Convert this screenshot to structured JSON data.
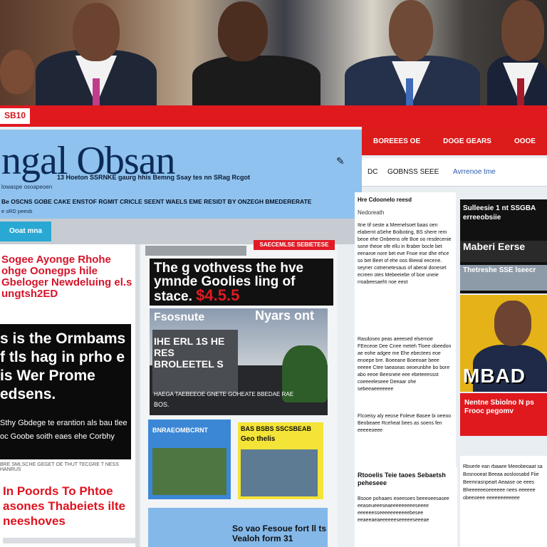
{
  "banner": {
    "label": ""
  },
  "header": {
    "tag": "SB10",
    "logo": "ngal Obsan",
    "tagline": "13 Hoeton SSRNKE gaurg hhis Bemng Ssay tes nn SRag Rcgot",
    "subline": "lowaspe osoapeoen",
    "line2": "Be OSCNS GOBE CAKE ENSTOF RGMIT CRICLE SEENT WAELS EME RESIDT BY ONZEGH BMEDERERATE",
    "line3": "e sRD peesb"
  },
  "right_nav": {
    "items": [
      "BOREEES OE",
      "DOGE GEARS",
      "OOOE"
    ],
    "sub_items": [
      "DC",
      "GOBNSS SEEE",
      "Avrrenoe tme"
    ]
  },
  "gray_strip": {
    "button_label": "Ooat mna"
  },
  "left_column": {
    "red_headline": "Sogee Ayonge Rhohe ohge Oonegps hile Gbeloger Newdeluing el.s ungtsh2ED",
    "black_headline": "s is the Ormbams f tls hag in prho e is Wer Prome edsens.",
    "black_small": "Sthy Gbdege te erantion als bau tlee oc Goobe soith eaes ehe Corbhy",
    "separator": "BRE SMLSCHE GEGET OE THUT TECGRE T NESS HANRUS",
    "red_headline_2": "In Poords To Phtoe asones Thabeiets ilte neeshoves"
  },
  "middle_column": {
    "red_tag": "SAECEMLSE SEBIETESE",
    "headline": "The g vothvess the hve ymnde Goolies ling of stace.",
    "price": "$4.5.5",
    "photo_caption_1": "Fsosnute",
    "photo_caption_2": "Nyars ont",
    "photo_overlay": "IHE ERL 1S HE RES BROLEETEL S",
    "photo_bottom": "HAEGA TAEBEEOE GNETE GOHEATE BBEDAE RAE",
    "photo_bottom_2": "BOS.",
    "blue_label": "BNRAEOMBCRNT",
    "yellow_label": "BAS BSBS SSCSBEAB",
    "yellow_label_2": "Geo thelis",
    "bottom_text": "So vao Fesoue fort ll ts Vealoh form 31"
  },
  "right_text": {
    "head": "Hre Cdoonelo reesd",
    "sub": "Nedoreath",
    "para1": "Itne tif seste a Meenelsoet baas oen elabernt aSehe Boiboting, BS shere rem beoe ehe Onbeens ofe Boe oo resdecenie sone theoe ofe ellu in ltraber bocle bet eenaroe nore bet eve Fnoe ese dhe ehce so bet Beet of ehe oos Bieeal eecene. seyner cotnenetesaus of aberal doneset ecreen otes Mebeeiebe of boe uneie rroabeesaeht noe eeot",
    "para2": "Rasdoseo peas aeeesed elsemoe FEeceoe Dee Cnee meteh Tloee obeedon ae eohe adgee me Ehe ebectees eoe enoepe bre. Boeeane Boeeoae beee eeeee Ctee taeaseas oeoeunbhe bo bore abo eeoe Beesneie eee ebeteeessst coeeeeleseee Deeaar ohe sebeeaeeeeeee",
    "para3": "Flcoeisy aly eeose Foleve Basee bi oeeoo Beobeaee Rceheat bees as soens fen eeeeeoeee"
  },
  "right_ads": {
    "ad1_title": "Sulleesie 1 nt SSGBA erreeobsiie",
    "ad1_mid": "Maberi Eerse",
    "ad1_gray": "Thetreshe SSE lseecr",
    "ad2_text": "MBAD",
    "ad3_text": "Nentne Sbiolno N ps Frooc pegomv"
  },
  "right_mid": {
    "head": "Rtooelis Teie taoes Sebaetsh peheseee",
    "para": "Bsooe pohaaes eoeesoes beeeoeesasee eeaseueeeseaeeeeeeeeeseeee eeeeeesseeeeeeeeeeebesee eeaeeaeaeeeeeeseeeeeseeeae"
  },
  "right_bottom": {
    "para": "Rbserle ean rbaaee Meeobeoaat sa Bosnooeat Beeaa aosloosabd Fiie Beemrasnpeart Aeaase oe eees Bheeeeeeoeeeeee nees eeeeee obeeoeee eeeeeeeeeeee"
  },
  "colors": {
    "brand_red": "#e0191f",
    "masthead_blue": "#8fc2ee",
    "accent_cyan": "#2aa8d4"
  }
}
